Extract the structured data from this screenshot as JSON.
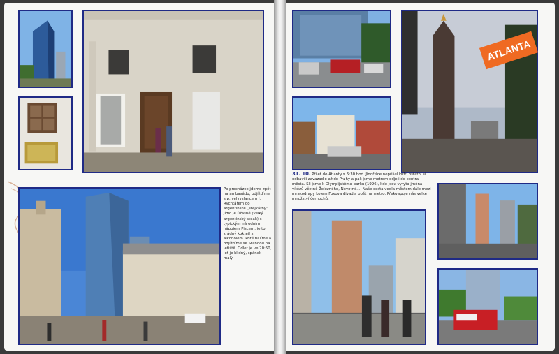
{
  "spread": {
    "left_caption": "Po procházce jdeme zpět na ambasádu, odjíždíme s p. velvyslancem J. Rychtářem do argentinské „stejkárny\". Jídlo je úžasné (velký argentinský steak) s typickým národním nápojem Piscem, je to zrádný koktejl s alkoholem. Poté balíme a odjíždíme se Standou na letiště. Odlet je ve 20:50, let je klidný, spánek malý.",
    "right_caption_date": "31. 10.",
    "right_caption_text": "Přílet do Atlanty v 5:30 hod. Jindříšce nepřišel kufr, ostatní si odbavili zavazadlo až do Prahy a pak jsme metrem odjeli do centra města. Šli jsme k Olympijskému parku (1996), kde jsou vyryta jména vítězů včetně Železného, Novotné.... Našе cesta vedla městem dále mezi mrakodrapy kolem Foxova divadla opět na metro. Překvapuje nás velké množství černochů.",
    "badge": "ATLANTA"
  },
  "photos": [
    {
      "name": "photo-santiago-skyscraper-small",
      "subject": "glass tower"
    },
    {
      "name": "photo-embassy-plaque",
      "subject": "plaque"
    },
    {
      "name": "photo-embassy-doorway",
      "subject": "embassy facade"
    },
    {
      "name": "photo-santiago-plaza",
      "subject": "plaza"
    },
    {
      "name": "photo-atlanta-parking",
      "subject": "parking"
    },
    {
      "name": "photo-atlanta-street",
      "subject": "street"
    },
    {
      "name": "photo-atlanta-bofa-tower",
      "subject": "tower at dusk"
    },
    {
      "name": "photo-atlanta-bridge-group",
      "subject": "bridge"
    },
    {
      "name": "photo-atlanta-avenue",
      "subject": "avenue"
    },
    {
      "name": "photo-atlanta-ambulance",
      "subject": "ambulance"
    }
  ],
  "colors": {
    "frame": "#1f2a86",
    "badge": "#ef6a22",
    "date": "#1f2a86"
  }
}
